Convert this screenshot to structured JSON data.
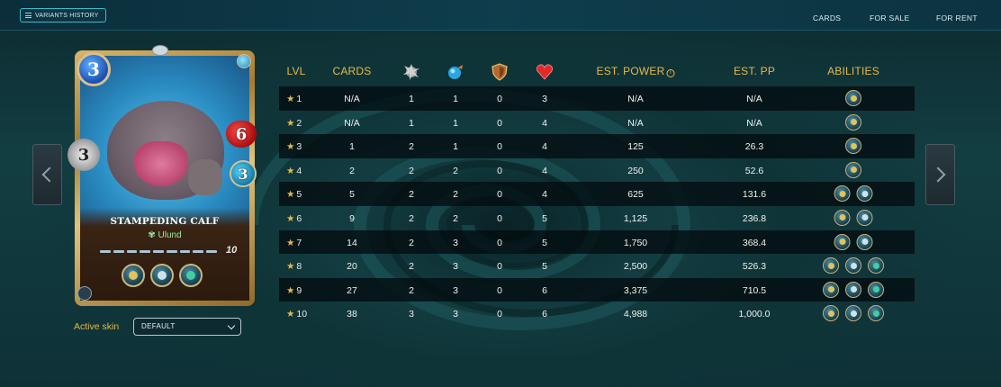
{
  "topbar": {
    "variants_label": "VARIANTS HISTORY",
    "nav": [
      "CARDS",
      "FOR SALE",
      "FOR RENT"
    ]
  },
  "card": {
    "name": "STAMPEDING CALF",
    "faction": "Ulund",
    "mana": "3",
    "melee": "3",
    "health": "6",
    "speed": "3",
    "level": "10",
    "abilities": [
      "stomp-icon",
      "skull-icon",
      "claw-icon"
    ],
    "element_color": "#5fd2ff"
  },
  "skin": {
    "label": "Active skin",
    "value": "DEFAULT"
  },
  "table": {
    "headers": {
      "lvl": "LVL",
      "cards": "CARDS",
      "melee_icon": "melee-attack-icon",
      "speed_icon": "speed-icon",
      "armor_icon": "armor-icon",
      "health_icon": "health-icon",
      "est_power": "EST. POWER",
      "est_pp": "EST. PP",
      "abilities": "ABILITIES"
    },
    "rows": [
      {
        "lvl": "1",
        "cards": "N/A",
        "melee": "1",
        "speed": "1",
        "armor": "0",
        "health": "3",
        "power": "N/A",
        "pp": "N/A",
        "abilities": [
          "stomp-icon"
        ]
      },
      {
        "lvl": "2",
        "cards": "N/A",
        "melee": "1",
        "speed": "1",
        "armor": "0",
        "health": "4",
        "power": "N/A",
        "pp": "N/A",
        "abilities": [
          "stomp-icon"
        ]
      },
      {
        "lvl": "3",
        "cards": "1",
        "melee": "2",
        "speed": "1",
        "armor": "0",
        "health": "4",
        "power": "125",
        "pp": "26.3",
        "abilities": [
          "stomp-icon"
        ]
      },
      {
        "lvl": "4",
        "cards": "2",
        "melee": "2",
        "speed": "2",
        "armor": "0",
        "health": "4",
        "power": "250",
        "pp": "52.6",
        "abilities": [
          "stomp-icon"
        ]
      },
      {
        "lvl": "5",
        "cards": "5",
        "melee": "2",
        "speed": "2",
        "armor": "0",
        "health": "4",
        "power": "625",
        "pp": "131.6",
        "abilities": [
          "stomp-icon",
          "skull-icon"
        ]
      },
      {
        "lvl": "6",
        "cards": "9",
        "melee": "2",
        "speed": "2",
        "armor": "0",
        "health": "5",
        "power": "1,125",
        "pp": "236.8",
        "abilities": [
          "stomp-icon",
          "skull-icon"
        ]
      },
      {
        "lvl": "7",
        "cards": "14",
        "melee": "2",
        "speed": "3",
        "armor": "0",
        "health": "5",
        "power": "1,750",
        "pp": "368.4",
        "abilities": [
          "stomp-icon",
          "skull-icon"
        ]
      },
      {
        "lvl": "8",
        "cards": "20",
        "melee": "2",
        "speed": "3",
        "armor": "0",
        "health": "5",
        "power": "2,500",
        "pp": "526.3",
        "abilities": [
          "stomp-icon",
          "skull-icon",
          "claw-icon"
        ]
      },
      {
        "lvl": "9",
        "cards": "27",
        "melee": "2",
        "speed": "3",
        "armor": "0",
        "health": "6",
        "power": "3,375",
        "pp": "710.5",
        "abilities": [
          "stomp-icon",
          "skull-icon",
          "claw-icon"
        ]
      },
      {
        "lvl": "10",
        "cards": "38",
        "melee": "3",
        "speed": "3",
        "armor": "0",
        "health": "6",
        "power": "4,988",
        "pp": "1,000.0",
        "abilities": [
          "stomp-icon",
          "skull-icon",
          "claw-icon"
        ]
      }
    ]
  },
  "colors": {
    "accent_gold": "#e6b94a",
    "row_dark": "#020c10",
    "bg_teal": "#123e42"
  }
}
